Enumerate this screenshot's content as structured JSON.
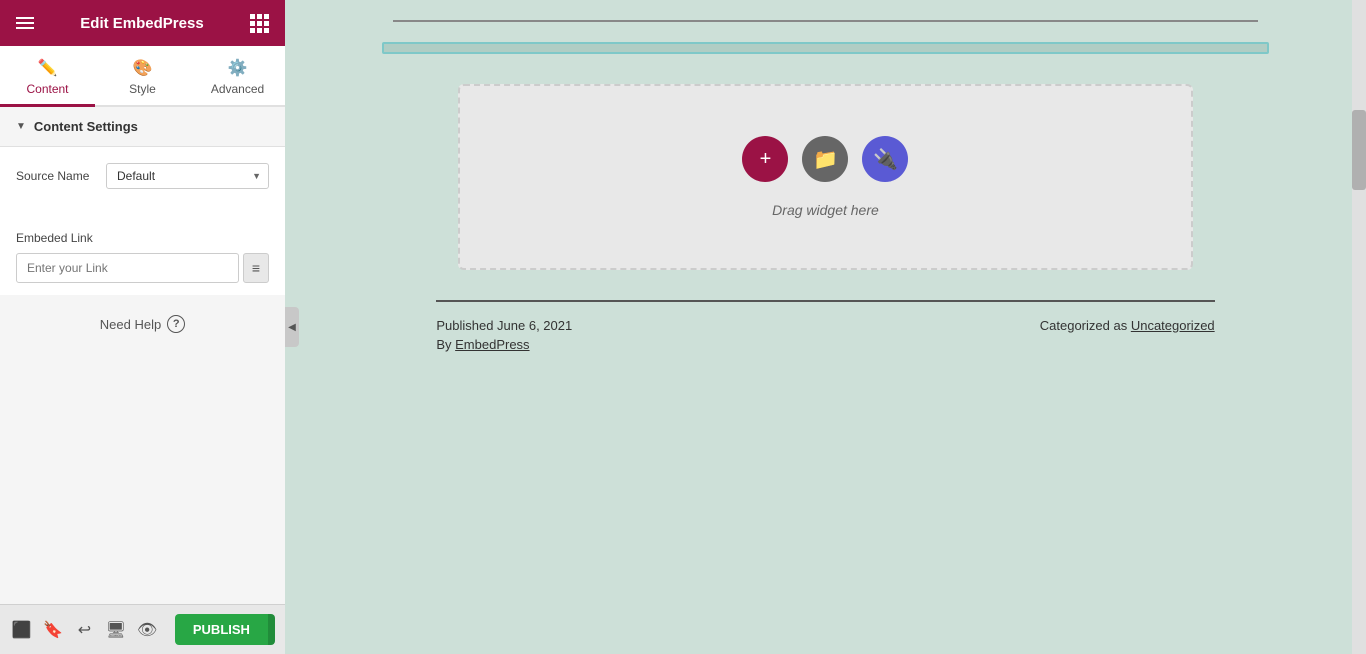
{
  "header": {
    "title": "Edit EmbedPress",
    "hamburger_label": "menu",
    "grid_label": "grid"
  },
  "tabs": [
    {
      "id": "content",
      "label": "Content",
      "icon": "✏️",
      "active": true
    },
    {
      "id": "style",
      "label": "Style",
      "icon": "🎨",
      "active": false
    },
    {
      "id": "advanced",
      "label": "Advanced",
      "icon": "⚙️",
      "active": false
    }
  ],
  "content_settings": {
    "section_label": "Content Settings",
    "source_name_label": "Source Name",
    "source_name_default": "Default",
    "source_name_options": [
      "Default"
    ],
    "embed_link_label": "Embeded Link",
    "embed_link_placeholder": "Enter your Link",
    "embed_btn_icon": "≡"
  },
  "need_help": {
    "label": "Need Help",
    "icon": "?"
  },
  "bottom_bar": {
    "icons": [
      "layers",
      "bookmark",
      "undo",
      "desktop",
      "eye"
    ],
    "publish_label": "PUBLISH",
    "publish_arrow": "▲"
  },
  "main_area": {
    "drag_widget_text": "Drag widget here",
    "add_btn_icon": "+",
    "folder_btn_icon": "📁",
    "plugin_btn_icon": "🔌",
    "published_text": "Published June 6, 2021",
    "categorized_text": "Categorized as",
    "category_link": "Uncategorized",
    "by_text": "By",
    "author_link": "EmbedPress"
  },
  "colors": {
    "brand": "#9b1245",
    "active_tab": "#9b1245",
    "publish_green": "#28a745",
    "plugin_blue": "#5a5ad4",
    "folder_gray": "#666666"
  }
}
